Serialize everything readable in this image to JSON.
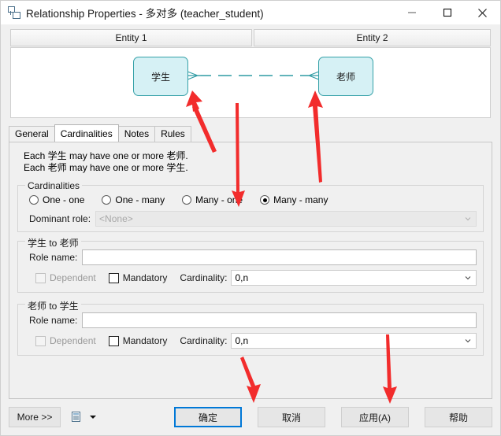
{
  "window": {
    "title": "Relationship Properties - 多对多 (teacher_student)",
    "icon": "relationship-icon",
    "controls": {
      "minimize": "minimize-icon",
      "maximize": "maximize-icon",
      "close": "close-icon"
    }
  },
  "diagram": {
    "headers": [
      {
        "label": "Entity 1"
      },
      {
        "label": "Entity 2"
      }
    ],
    "entities": [
      {
        "label": "学生"
      },
      {
        "label": "老师"
      }
    ],
    "connector": {
      "style": "dashed",
      "color": "#2f9ba3",
      "left_end": "crows-foot",
      "right_end": "crows-foot"
    }
  },
  "tabs": [
    {
      "label": "General",
      "selected": false
    },
    {
      "label": "Cardinalities",
      "selected": true
    },
    {
      "label": "Notes",
      "selected": false
    },
    {
      "label": "Rules",
      "selected": false
    }
  ],
  "cardinalities_page": {
    "description": [
      "Each 学生 may have one or more 老师.",
      "Each 老师 may have one or more 学生."
    ],
    "cardinalities_group": {
      "title": "Cardinalities",
      "options": [
        {
          "label": "One - one",
          "checked": false
        },
        {
          "label": "One - many",
          "checked": false
        },
        {
          "label": "Many - one",
          "checked": false
        },
        {
          "label": "Many - many",
          "checked": true
        }
      ],
      "dominant_role": {
        "label": "Dominant role:",
        "value": "<None>",
        "disabled": true
      }
    },
    "role_groups": [
      {
        "title": "学生 to 老师",
        "role_name_label": "Role name:",
        "role_name_value": "",
        "dependent": {
          "label": "Dependent",
          "checked": false,
          "disabled": true
        },
        "mandatory": {
          "label": "Mandatory",
          "checked": false,
          "disabled": false
        },
        "cardinality_label": "Cardinality:",
        "cardinality_value": "0,n"
      },
      {
        "title": "老师 to 学生",
        "role_name_label": "Role name:",
        "role_name_value": "",
        "dependent": {
          "label": "Dependent",
          "checked": false,
          "disabled": true
        },
        "mandatory": {
          "label": "Mandatory",
          "checked": false,
          "disabled": false
        },
        "cardinality_label": "Cardinality:",
        "cardinality_value": "0,n"
      }
    ]
  },
  "bottom_bar": {
    "more_label": "More >>",
    "report_icon": "report-icon",
    "dropdown_icon": "chevron-down-icon",
    "buttons": [
      {
        "label": "确定",
        "primary": true
      },
      {
        "label": "取消",
        "primary": false
      },
      {
        "label": "应用(A)",
        "primary": false
      },
      {
        "label": "帮助",
        "primary": false
      }
    ]
  },
  "annotations": {
    "color": "#f22c2c",
    "arrows": [
      {
        "name": "arrow-to-left-crows-foot",
        "points_to": "学生 crow's foot"
      },
      {
        "name": "arrow-to-many-many-radio",
        "points_to": "Many - many radio"
      },
      {
        "name": "arrow-to-right-crows-foot",
        "points_to": "老师 crow's foot"
      },
      {
        "name": "arrow-to-ok-button",
        "points_to": "确定 button"
      },
      {
        "name": "arrow-to-apply-button",
        "points_to": "应用(A) button"
      }
    ]
  }
}
